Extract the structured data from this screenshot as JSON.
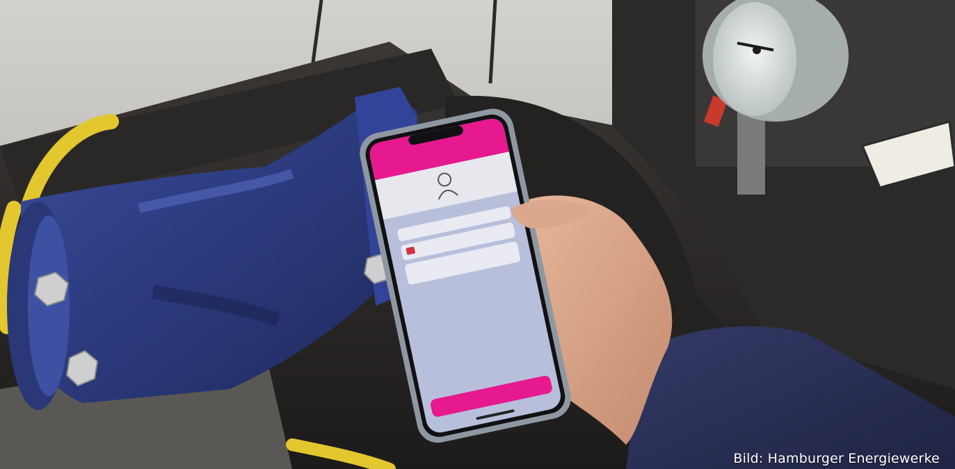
{
  "photo": {
    "description_icons": [
      "valve-icon",
      "smartphone-icon",
      "pressure-gauge-icon",
      "hand-icon"
    ],
    "colors": {
      "wall": "#c9c7c2",
      "insulation": "#2e2c2a",
      "valve": "#2f3f86",
      "valve_highlight": "#4a5cb0",
      "bolt": "#c8c8c8",
      "yellow_hose": "#e0c530",
      "phone_frame": "#9aa3ad",
      "app_header": "#e6198f",
      "app_body": "#b9c0dc",
      "app_button": "#e6198f",
      "sleeve": "#2a2f55",
      "skin": "#d9a68a"
    }
  },
  "credit": {
    "text": "Bild: Hamburger Energiewerke"
  }
}
